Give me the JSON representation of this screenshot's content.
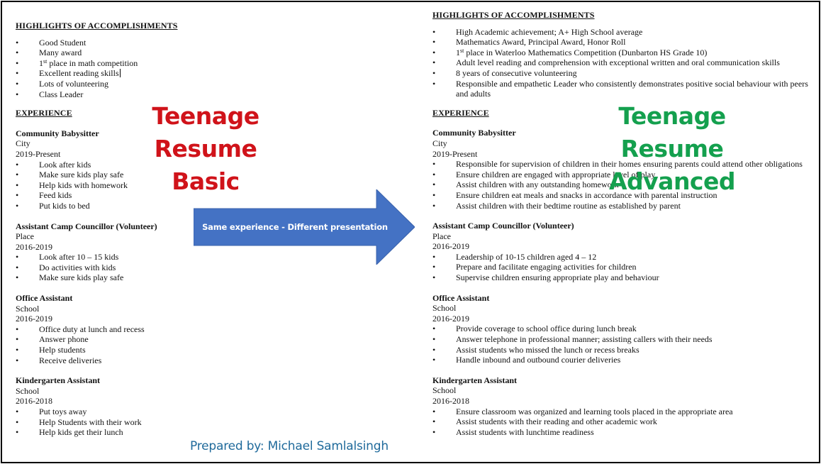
{
  "basic": {
    "banner_line1": "Teenage Resume",
    "banner_line2": "Basic",
    "banner_color": "#d0131a",
    "highlights_heading": "HIGHLIGHTS OF ACCOMPLISHMENTS",
    "highlights": [
      "Good Student",
      "Many award",
      {
        "pre": "1",
        "sup": "st",
        "post": " place in math competition"
      },
      "Excellent reading skills",
      "Lots of volunteering",
      "Class Leader"
    ],
    "experience_heading": "EXPERIENCE",
    "jobs": [
      {
        "title": "Community Babysitter",
        "location": "City",
        "dates": "2019-Present",
        "duties": [
          "Look after kids",
          "Make sure kids play safe",
          "Help kids with homework",
          "Feed kids",
          "Put kids to bed"
        ]
      },
      {
        "title": "Assistant Camp Councillor (Volunteer)",
        "location": "Place",
        "dates": "2016-2019",
        "duties": [
          "Look after 10 – 15 kids",
          "Do activities with kids",
          "Make sure kids play safe"
        ]
      },
      {
        "title": "Office Assistant",
        "location": "School",
        "dates": "2016-2019",
        "duties": [
          "Office duty at lunch and recess",
          "Answer phone",
          "Help students",
          "Receive deliveries"
        ]
      },
      {
        "title": "Kindergarten Assistant",
        "location": "School",
        "dates": "2016-2018",
        "duties": [
          "Put toys away",
          "Help Students with their work",
          "Help kids get their lunch"
        ]
      }
    ]
  },
  "advanced": {
    "banner_line1": "Teenage Resume",
    "banner_line2": "Advanced",
    "banner_color": "#14a04e",
    "highlights_heading": "HIGHLIGHTS OF ACCOMPLISHMENTS",
    "highlights": [
      "High Academic achievement; A+ High School average",
      "Mathematics Award, Principal Award, Honor Roll",
      {
        "pre": "1",
        "sup": "st",
        "post": " place in Waterloo Mathematics Competition (Dunbarton HS Grade 10)"
      },
      "Adult level reading and comprehension with exceptional written and oral communication skills",
      "8 years of consecutive volunteering",
      "Responsible and empathetic Leader who consistently demonstrates positive social behaviour with peers and adults"
    ],
    "experience_heading": "EXPERIENCE",
    "jobs": [
      {
        "title": "Community Babysitter",
        "location": "City",
        "dates": "2019-Present",
        "duties": [
          "Responsible for supervision of children in their homes ensuring parents could attend other obligations",
          "Ensure children are engaged with appropriate level of play",
          "Assist children with any outstanding homework",
          "Ensure children eat meals and snacks in accordance with parental instruction",
          "Assist children with their bedtime routine as established by parent"
        ]
      },
      {
        "title": "Assistant Camp Councillor (Volunteer)",
        "location": "Place",
        "dates": "2016-2019",
        "duties": [
          "Leadership of 10-15 children aged 4 – 12",
          "Prepare and facilitate engaging activities for children",
          "Supervise children ensuring appropriate play and behaviour"
        ]
      },
      {
        "title": "Office Assistant",
        "location": "School",
        "dates": "2016-2019",
        "duties": [
          "Provide coverage to school office during lunch break",
          "Answer telephone in professional manner; assisting callers with their needs",
          "Assist students who missed the lunch or recess breaks",
          "Handle inbound and outbound courier deliveries"
        ]
      },
      {
        "title": "Kindergarten Assistant",
        "location": "School",
        "dates": "2016-2018",
        "duties": [
          "Ensure classroom was organized and learning tools placed in the appropriate area",
          "Assist students with their reading and other academic work",
          "Assist students with lunchtime readiness"
        ]
      }
    ]
  },
  "arrow": {
    "label": "Same experience - Different presentation",
    "color": "#4472c4",
    "text_color": "#ffffff"
  },
  "credit": {
    "text": "Prepared by: Michael Samlalsingh",
    "color": "#1f6a9b"
  }
}
